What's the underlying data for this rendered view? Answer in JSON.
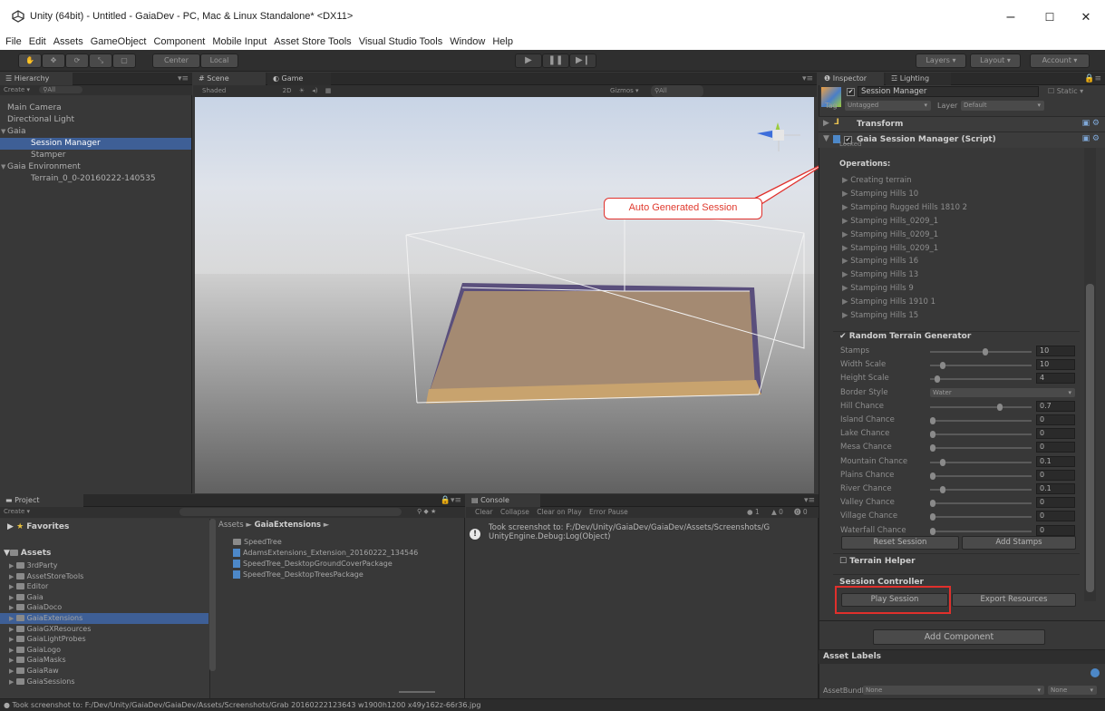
{
  "window": {
    "title": "Unity (64bit) - Untitled - GaiaDev - PC, Mac & Linux Standalone* <DX11>",
    "min": "–",
    "max": "☐",
    "close": "✕"
  },
  "menu": [
    "File",
    "Edit",
    "Assets",
    "GameObject",
    "Component",
    "Mobile Input",
    "Asset Store Tools",
    "Visual Studio Tools",
    "Window",
    "Help"
  ],
  "toolbar": {
    "center": "Center",
    "local": "Local",
    "layers": "Layers",
    "layout": "Layout",
    "account": "Account"
  },
  "hierarchy": {
    "tab": "Hierarchy",
    "create": "Create",
    "search": "All",
    "items": [
      {
        "label": "Main Camera",
        "indent": 0,
        "sel": false,
        "fold": ""
      },
      {
        "label": "Directional Light",
        "indent": 0,
        "sel": false,
        "fold": ""
      },
      {
        "label": "Gaia",
        "indent": 0,
        "sel": false,
        "fold": "▼"
      },
      {
        "label": "Session Manager",
        "indent": 1,
        "sel": true,
        "fold": ""
      },
      {
        "label": "Stamper",
        "indent": 1,
        "sel": false,
        "fold": ""
      },
      {
        "label": "Gaia Environment",
        "indent": 0,
        "sel": false,
        "fold": "▼"
      },
      {
        "label": "Terrain_0_0-20160222-140535",
        "indent": 1,
        "sel": false,
        "fold": ""
      }
    ]
  },
  "scene": {
    "tab": "Scene",
    "game_tab": "Game",
    "shaded": "Shaded",
    "twod": "2D",
    "gizmos": "Gizmos",
    "search": "All",
    "annotation": "Auto Generated Session"
  },
  "inspector": {
    "tab": "Inspector",
    "lighting_tab": "Lighting",
    "object_name": "Session Manager",
    "static": "Static",
    "tag_label": "Tag",
    "tag_value": "Untagged",
    "layer_label": "Layer",
    "layer_value": "Default",
    "transform": "Transform",
    "component": "Gaia Session Manager (Script)",
    "locked": "Locked",
    "operations_label": "Operations:",
    "operations": [
      "Creating terrain",
      "Stamping Hills 10",
      "Stamping Rugged Hills 1810 2",
      "Stamping Hills_0209_1",
      "Stamping Hills_0209_1",
      "Stamping Hills_0209_1",
      "Stamping Hills 16",
      "Stamping Hills 13",
      "Stamping Hills 9",
      "Stamping Hills 1910 1",
      "Stamping Hills 15"
    ],
    "rtg_label": "Random Terrain Generator",
    "params": [
      {
        "label": "Stamps",
        "value": "10",
        "pos": 0.55
      },
      {
        "label": "Width Scale",
        "value": "10",
        "pos": 0.1
      },
      {
        "label": "Height Scale",
        "value": "4",
        "pos": 0.05
      },
      {
        "label": "Border Style",
        "value": "Water",
        "pos": -1
      },
      {
        "label": "Hill Chance",
        "value": "0.7",
        "pos": 0.7
      },
      {
        "label": "Island Chance",
        "value": "0",
        "pos": 0
      },
      {
        "label": "Lake Chance",
        "value": "0",
        "pos": 0
      },
      {
        "label": "Mesa Chance",
        "value": "0",
        "pos": 0
      },
      {
        "label": "Mountain Chance",
        "value": "0.1",
        "pos": 0.1
      },
      {
        "label": "Plains Chance",
        "value": "0",
        "pos": 0
      },
      {
        "label": "River Chance",
        "value": "0.1",
        "pos": 0.1
      },
      {
        "label": "Valley Chance",
        "value": "0",
        "pos": 0
      },
      {
        "label": "Village Chance",
        "value": "0",
        "pos": 0
      },
      {
        "label": "Waterfall Chance",
        "value": "0",
        "pos": 0
      }
    ],
    "reset": "Reset Session",
    "add_stamps": "Add Stamps",
    "terrain_helper": "Terrain Helper",
    "session_controller": "Session Controller",
    "play": "Play Session",
    "export": "Export Resources",
    "add_component": "Add Component",
    "asset_labels": "Asset Labels",
    "asset_bundle": "AssetBundle",
    "none1": "None",
    "none2": "None"
  },
  "project": {
    "tab": "Project",
    "create": "Create",
    "favorites": "Favorites",
    "assets": "Assets",
    "folders": [
      {
        "label": "3rdParty",
        "sel": false
      },
      {
        "label": "AssetStoreTools",
        "sel": false
      },
      {
        "label": "Editor",
        "sel": false
      },
      {
        "label": "Gaia",
        "sel": false
      },
      {
        "label": "GaiaDoco",
        "sel": false
      },
      {
        "label": "GaiaExtensions",
        "sel": true
      },
      {
        "label": "GaiaGXResources",
        "sel": false
      },
      {
        "label": "GaiaLightProbes",
        "sel": false
      },
      {
        "label": "GaiaLogo",
        "sel": false
      },
      {
        "label": "GaiaMasks",
        "sel": false
      },
      {
        "label": "GaiaRaw",
        "sel": false
      },
      {
        "label": "GaiaSessions",
        "sel": false
      }
    ],
    "breadcrumb_root": "Assets",
    "breadcrumb_sep": "►",
    "breadcrumb_current": "GaiaExtensions",
    "files": [
      {
        "label": "SpeedTree",
        "kind": "folder"
      },
      {
        "label": "AdamsExtensions_Extension_20160222_134546",
        "kind": "script"
      },
      {
        "label": "SpeedTree_DesktopGroundCoverPackage",
        "kind": "script"
      },
      {
        "label": "SpeedTree_DesktopTreesPackage",
        "kind": "script"
      }
    ]
  },
  "console": {
    "tab": "Console",
    "clear": "Clear",
    "collapse": "Collapse",
    "clear_on_play": "Clear on Play",
    "error_pause": "Error Pause",
    "info_count": "1",
    "warn_count": "0",
    "err_count": "0",
    "line1": "Took screenshot to: F:/Dev/Unity/GaiaDev/GaiaDev/Assets/Screenshots/G",
    "line2": "UnityEngine.Debug:Log(Object)"
  },
  "status": "Took screenshot to: F:/Dev/Unity/GaiaDev/GaiaDev/Assets/Screenshots/Grab 20160222123643 w1900h1200 x49y162z-66r36.jpg",
  "colors": {
    "selection": "#3e5f96",
    "highlight_box": "#e0302c",
    "callout_text": "#e03a2e"
  }
}
